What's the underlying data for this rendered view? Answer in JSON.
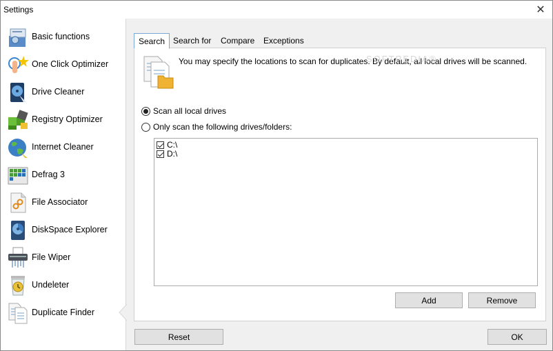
{
  "window": {
    "title": "Settings",
    "close_glyph": "✕"
  },
  "sidebar": {
    "items": [
      {
        "label": "Basic functions",
        "icon": "basic-functions-icon"
      },
      {
        "label": "One Click Optimizer",
        "icon": "one-click-optimizer-icon"
      },
      {
        "label": "Drive Cleaner",
        "icon": "drive-cleaner-icon"
      },
      {
        "label": "Registry Optimizer",
        "icon": "registry-optimizer-icon"
      },
      {
        "label": "Internet Cleaner",
        "icon": "internet-cleaner-icon"
      },
      {
        "label": "Defrag 3",
        "icon": "defrag-icon"
      },
      {
        "label": "File Associator",
        "icon": "file-associator-icon"
      },
      {
        "label": "DiskSpace Explorer",
        "icon": "diskspace-explorer-icon"
      },
      {
        "label": "File Wiper",
        "icon": "file-wiper-icon"
      },
      {
        "label": "Undeleter",
        "icon": "undeleter-icon"
      },
      {
        "label": "Duplicate Finder",
        "icon": "duplicate-finder-icon",
        "selected": true
      }
    ]
  },
  "tabs": [
    {
      "label": "Search",
      "active": true
    },
    {
      "label": "Search for"
    },
    {
      "label": "Compare"
    },
    {
      "label": "Exceptions"
    }
  ],
  "search_tab": {
    "info_text": "You may specify the locations to scan for duplicates. By default, all local drives will be scanned.",
    "watermark": "SOFTPEDIA®",
    "radio_all": {
      "label": "Scan all local drives",
      "checked": true
    },
    "radio_some": {
      "label": "Only scan the following drives/folders:",
      "checked": false
    },
    "locations": [
      {
        "label": "C:\\",
        "checked": true
      },
      {
        "label": "D:\\",
        "checked": true
      }
    ],
    "add_label": "Add",
    "remove_label": "Remove"
  },
  "footer": {
    "reset_label": "Reset",
    "ok_label": "OK"
  }
}
